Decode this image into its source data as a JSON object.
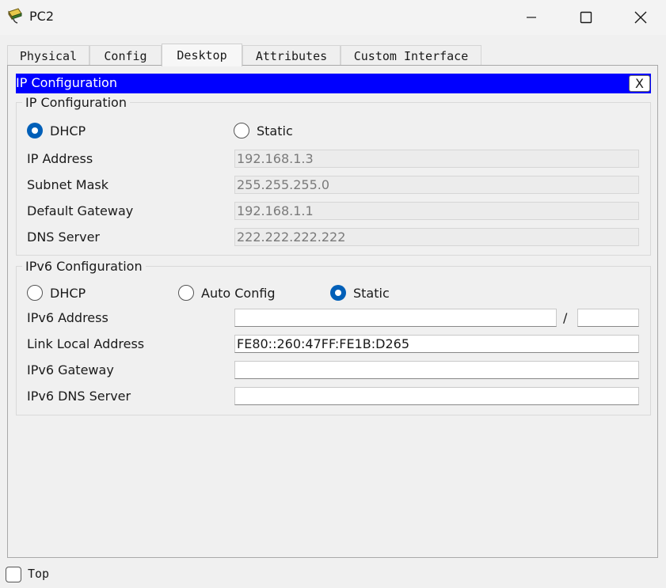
{
  "window": {
    "title": "PC2",
    "icon": "packet-tracer-pc-icon"
  },
  "tabs": [
    {
      "label": "Physical"
    },
    {
      "label": "Config"
    },
    {
      "label": "Desktop",
      "active": true
    },
    {
      "label": "Attributes"
    },
    {
      "label": "Custom Interface"
    }
  ],
  "dialog": {
    "title": "IP Configuration",
    "close_label": "X"
  },
  "ipv4": {
    "group_title": "IP Configuration",
    "mode_selected": "DHCP",
    "dhcp_label": "DHCP",
    "static_label": "Static",
    "ip_address_label": "IP Address",
    "ip_address_value": "192.168.1.3",
    "subnet_mask_label": "Subnet Mask",
    "subnet_mask_value": "255.255.255.0",
    "gateway_label": "Default Gateway",
    "gateway_value": "192.168.1.1",
    "dns_label": "DNS Server",
    "dns_value": "222.222.222.222"
  },
  "ipv6": {
    "group_title": "IPv6 Configuration",
    "mode_selected": "Static",
    "dhcp_label": "DHCP",
    "auto_label": "Auto Config",
    "static_label": "Static",
    "address_label": "IPv6 Address",
    "address_value": "",
    "prefix_separator": "/",
    "prefix_value": "",
    "link_local_label": "Link Local Address",
    "link_local_value": "FE80::260:47FF:FE1B:D265",
    "gateway_label": "IPv6 Gateway",
    "gateway_value": "",
    "dns_label": "IPv6 DNS Server",
    "dns_value": ""
  },
  "footer": {
    "top_label": "Top",
    "top_checked": false
  },
  "colors": {
    "dialog_header": "#0000ff",
    "radio_selected": "#005fb8"
  }
}
